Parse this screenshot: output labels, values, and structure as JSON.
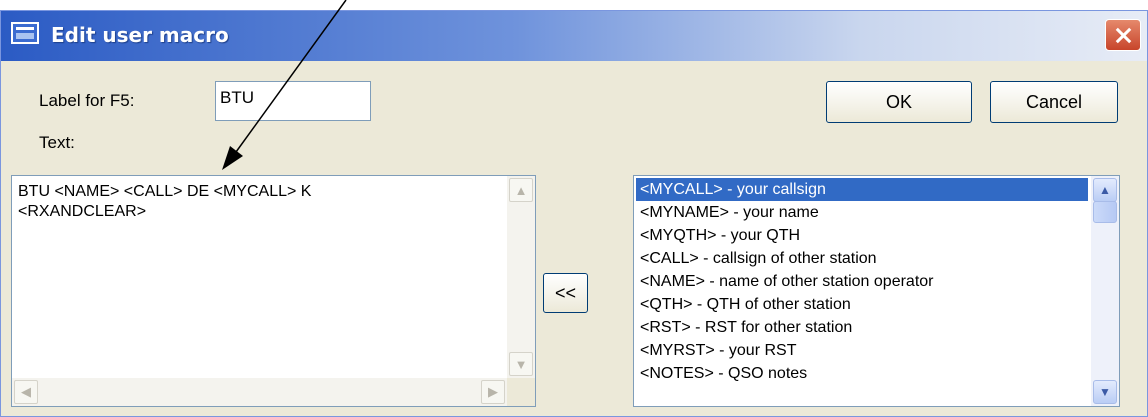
{
  "window": {
    "title": "Edit user macro",
    "close_icon": "close-icon"
  },
  "form": {
    "label_caption": "Label for F5:",
    "label_value": "BTU",
    "text_caption": "Text:",
    "macro_text": "BTU <NAME> <CALL> DE <MYCALL> K\n<RXANDCLEAR>"
  },
  "buttons": {
    "ok": "OK",
    "cancel": "Cancel",
    "insert": "<<"
  },
  "macro_list": {
    "selected_index": 0,
    "items": [
      "<MYCALL> - your callsign",
      "<MYNAME> - your name",
      "<MYQTH> - your QTH",
      "<CALL> - callsign of other station",
      "<NAME> - name of other station operator",
      "<QTH> - QTH of other station",
      "<RST> - RST for other station",
      "<MYRST> - your RST",
      "<NOTES> - QSO notes"
    ]
  },
  "colors": {
    "title_gradient_start": "#2b5bc4",
    "selection": "#316ac5",
    "close_button": "#c8452b"
  }
}
